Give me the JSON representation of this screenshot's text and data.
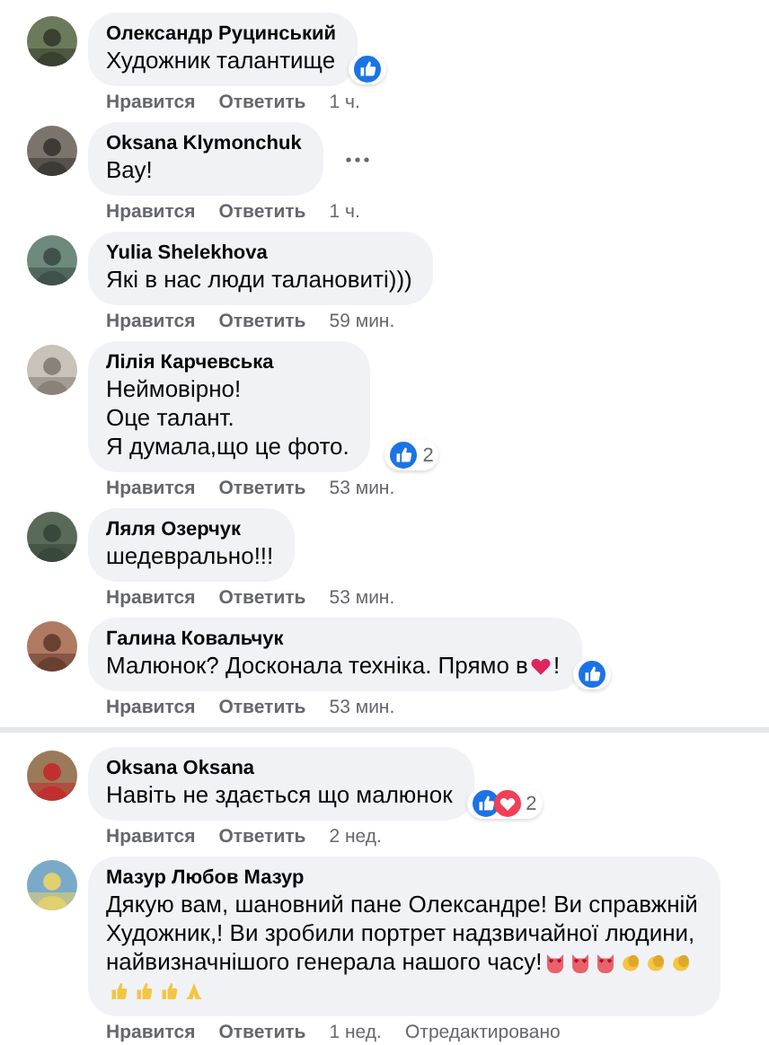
{
  "groups": [
    [
      {
        "author": "Олександр Руцинський",
        "lines": [
          [
            {
              "kind": "text",
              "text": "Художник талантище"
            }
          ]
        ],
        "reactions": [
          {
            "kind": "like"
          }
        ],
        "actions": [
          "Нравится",
          "Ответить"
        ],
        "time": "1 ч."
      },
      {
        "author": "Oksana Klymonchuk",
        "lines": [
          [
            {
              "kind": "text",
              "text": "Вау!"
            }
          ]
        ],
        "more": true,
        "actions": [
          "Нравится",
          "Ответить"
        ],
        "time": "1 ч."
      },
      {
        "author": "Yulia Shelekhova",
        "lines": [
          [
            {
              "kind": "text",
              "text": "Які в нас люди талановиті)))"
            }
          ]
        ],
        "actions": [
          "Нравится",
          "Ответить"
        ],
        "time": "59 мин."
      },
      {
        "author": "Лілія Карчевська",
        "lines": [
          [
            {
              "kind": "text",
              "text": "Неймовірно!"
            }
          ],
          [
            {
              "kind": "text",
              "text": "Оце талант."
            }
          ],
          [
            {
              "kind": "text",
              "text": "Я думала,що це фото."
            }
          ]
        ],
        "reactions": [
          {
            "kind": "like"
          }
        ],
        "reaction_count": "2",
        "actions": [
          "Нравится",
          "Ответить"
        ],
        "time": "53 мин."
      },
      {
        "author": "Ляля Озерчук",
        "lines": [
          [
            {
              "kind": "text",
              "text": "шедеврально!!!"
            }
          ]
        ],
        "actions": [
          "Нравится",
          "Ответить"
        ],
        "time": "53 мин."
      },
      {
        "author": "Галина Ковальчук",
        "lines": [
          [
            {
              "kind": "text",
              "text": "Малюнок? Досконала техніка. Прямо в"
            },
            {
              "kind": "heart"
            },
            {
              "kind": "text",
              "text": "!"
            }
          ]
        ],
        "reactions": [
          {
            "kind": "like"
          }
        ],
        "actions": [
          "Нравится",
          "Ответить"
        ],
        "time": "53 мин."
      }
    ],
    [
      {
        "author": "Oksana Oksana",
        "lines": [
          [
            {
              "kind": "text",
              "text": "Навіть не здається що малюнок"
            }
          ]
        ],
        "reactions": [
          {
            "kind": "like"
          },
          {
            "kind": "love"
          }
        ],
        "reaction_count": "2",
        "actions": [
          "Нравится",
          "Ответить"
        ],
        "time": "2 нед."
      },
      {
        "author": "Мазур Любов Мазур",
        "lines": [
          [
            {
              "kind": "text",
              "text": "Дякую вам, шановний пане Олександре! Ви справжній Художник,! Ви зробили портрет надзвичайної людини, найвизначнішого генерала нашого часу!"
            },
            {
              "kind": "hearteyes"
            },
            {
              "kind": "hearteyes"
            },
            {
              "kind": "hearteyes"
            },
            {
              "kind": "clap"
            },
            {
              "kind": "clap"
            },
            {
              "kind": "clap"
            },
            {
              "kind": "thumb"
            },
            {
              "kind": "thumb"
            },
            {
              "kind": "thumb"
            },
            {
              "kind": "pray"
            }
          ]
        ],
        "actions": [
          "Нравится",
          "Ответить"
        ],
        "time": "1 нед.",
        "edited": "Отредактировано"
      }
    ]
  ]
}
